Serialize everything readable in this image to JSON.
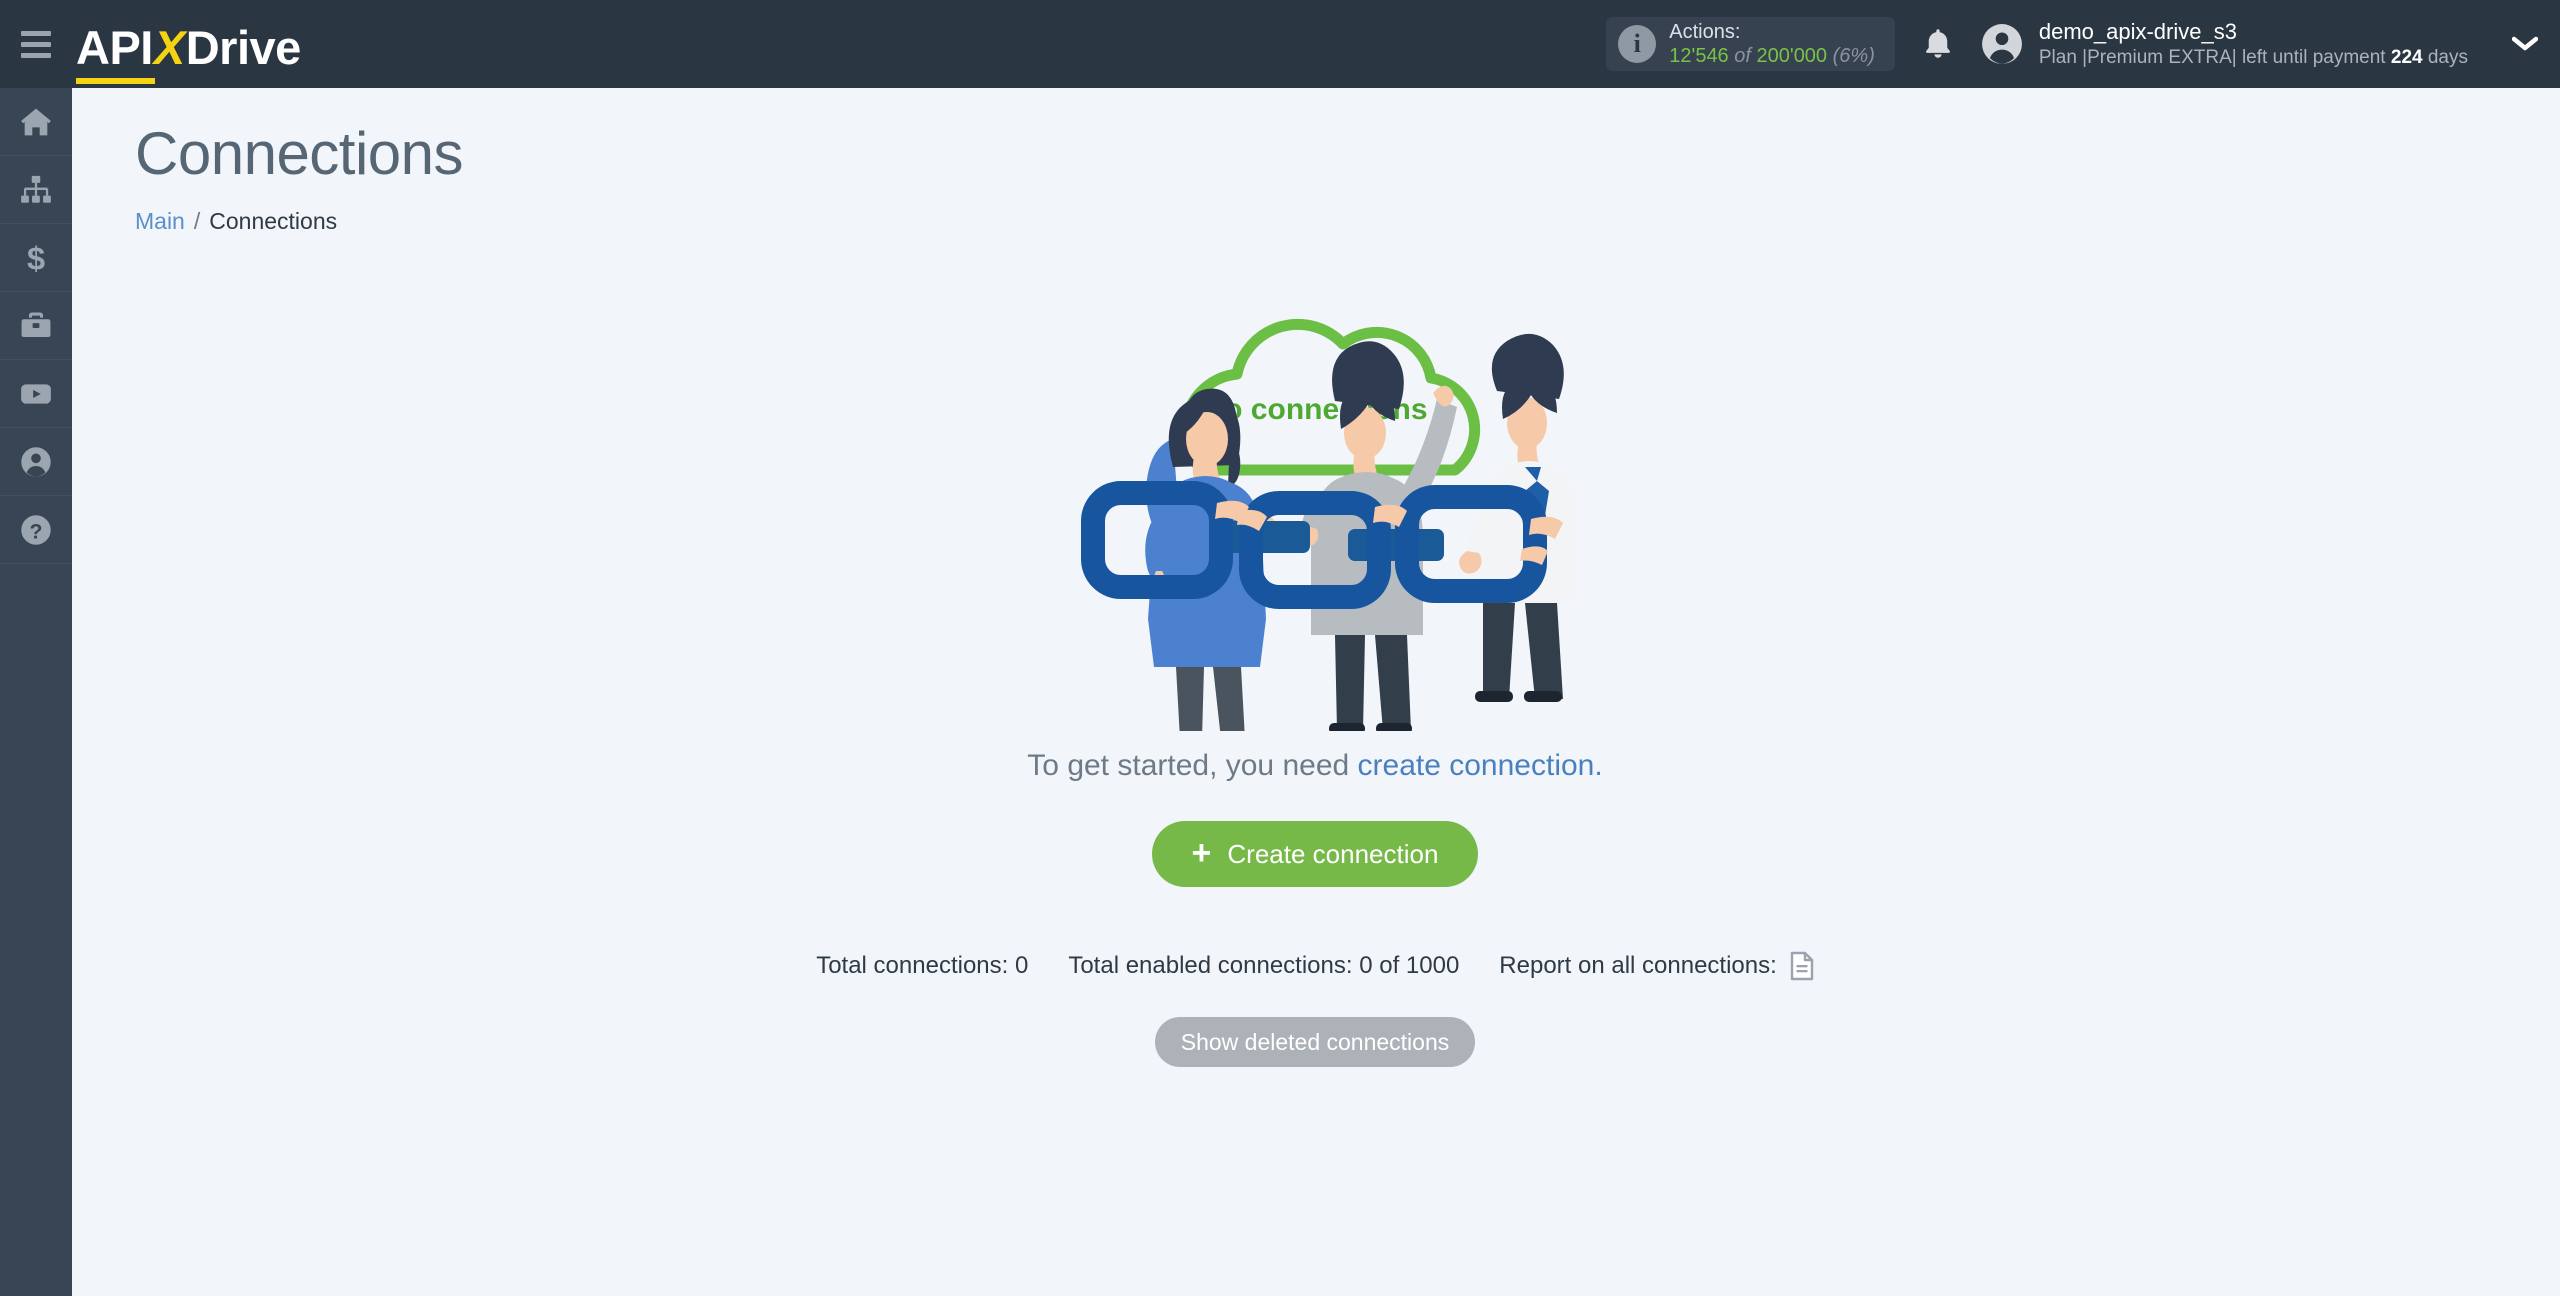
{
  "header": {
    "logo": {
      "part1": "API",
      "accent": "X",
      "part2": "Drive"
    },
    "menu_icon": "hamburger-icon",
    "actions": {
      "label": "Actions:",
      "used": "12'546",
      "of": "of",
      "total": "200'000",
      "percent": "(6%)",
      "info_icon": "i"
    },
    "notifications_icon": "bell-icon",
    "user": {
      "name": "demo_apix-drive_s3",
      "plan_prefix": "Plan |Premium EXTRA| left until payment",
      "days": "224",
      "plan_suffix": "days"
    }
  },
  "sidebar": {
    "items": [
      {
        "name": "home",
        "icon": "home-icon"
      },
      {
        "name": "connections",
        "icon": "sitemap-icon"
      },
      {
        "name": "billing",
        "icon": "dollar-icon"
      },
      {
        "name": "business",
        "icon": "briefcase-icon"
      },
      {
        "name": "videos",
        "icon": "youtube-icon"
      },
      {
        "name": "profile",
        "icon": "user-icon"
      },
      {
        "name": "help",
        "icon": "question-icon"
      }
    ]
  },
  "main": {
    "title": "Connections",
    "breadcrumb": {
      "root": "Main",
      "separator": "/",
      "current": "Connections"
    },
    "empty_state": {
      "cloud_label": "No connections",
      "prompt_plain": "To get started, you need ",
      "prompt_link": "create connection.",
      "create_button": "Create connection",
      "create_button_icon": "plus-icon"
    },
    "stats": {
      "total_connections": "Total connections: 0",
      "total_enabled": "Total enabled connections: 0 of 1000",
      "report_label": "Report on all connections:",
      "report_icon": "document-icon"
    },
    "show_deleted_button": "Show deleted connections"
  },
  "colors": {
    "header_bg": "#2b3643",
    "sidebar_bg": "#374554",
    "content_bg": "#f2f6fb",
    "accent_yellow": "#f5d312",
    "accent_green": "#76b948",
    "link_blue": "#4a80bd",
    "chain_blue": "#17569f"
  }
}
